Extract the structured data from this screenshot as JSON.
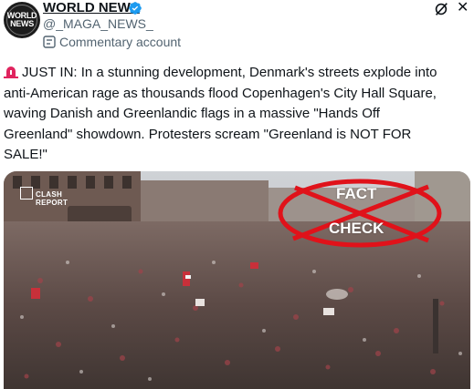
{
  "header": {
    "avatar_text_line1": "WORLD",
    "avatar_text_line2": "NEWS",
    "display_name": "WORLD NEWS",
    "handle": "@_MAGA_NEWS_",
    "account_label": "Commentary account"
  },
  "tweet": {
    "text": "JUST IN: In a stunning development, Denmark's streets explode into\nanti-American rage as thousands flood Copenhagen's City Hall Square,\nwaving Danish and Greenlandic flags in a massive \"Hands Off\nGreenland\" showdown. Protesters scream \"Greenland is NOT FOR\nSALE!\""
  },
  "media": {
    "watermark_line1": "CLASH",
    "watermark_line2": "REPORT",
    "stamp_word1": "FACT",
    "stamp_word2": "CHECK"
  },
  "colors": {
    "verified": "#1d9bf0",
    "stamp": "#e0121a",
    "siren": "#e0245e"
  },
  "icons": [
    "verified-badge-icon",
    "grok-icon",
    "close-icon",
    "commentary-icon",
    "siren-icon"
  ]
}
